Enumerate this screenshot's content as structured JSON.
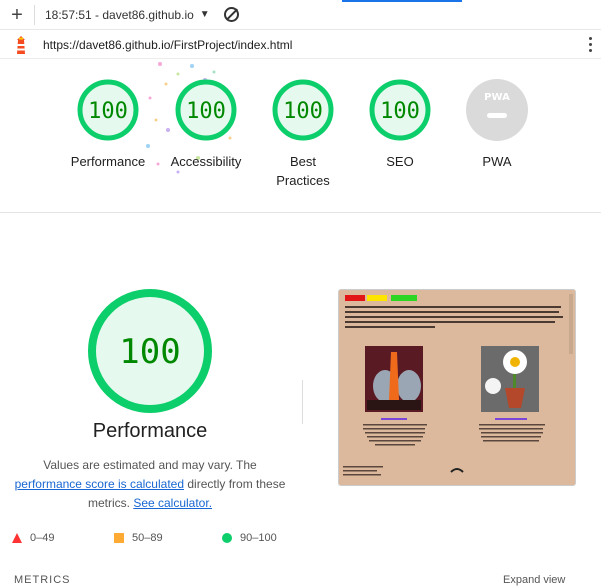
{
  "toolbar": {
    "report_label": "18:57:51 - davet86.github.io"
  },
  "url": "https://davet86.github.io/FirstProject/index.html",
  "gauges": [
    {
      "label": "Performance",
      "score": "100"
    },
    {
      "label": "Accessibility",
      "score": "100"
    },
    {
      "label": "Best Practices",
      "score": "100"
    },
    {
      "label": "SEO",
      "score": "100"
    },
    {
      "label": "PWA",
      "score": ""
    }
  ],
  "pwa_badge": "PWA",
  "performance": {
    "score": "100",
    "title": "Performance",
    "desc_1": "Values are estimated and may vary. The",
    "desc_link": "performance score is calculated",
    "desc_2": "directly from these metrics.",
    "calc_link": "See calculator."
  },
  "legend": [
    {
      "range": "0–49",
      "color": "#ff3333"
    },
    {
      "range": "50–89",
      "color": "#ffaa33"
    },
    {
      "range": "90–100",
      "color": "#0cce6b"
    }
  ],
  "metrics_header": "METRICS",
  "expand_view": "Expand view",
  "colors": {
    "pass": "#0cce6b",
    "pass_fill": "#e6f9ee",
    "pass_text": "#008800",
    "pwa_grey": "#dadada"
  }
}
